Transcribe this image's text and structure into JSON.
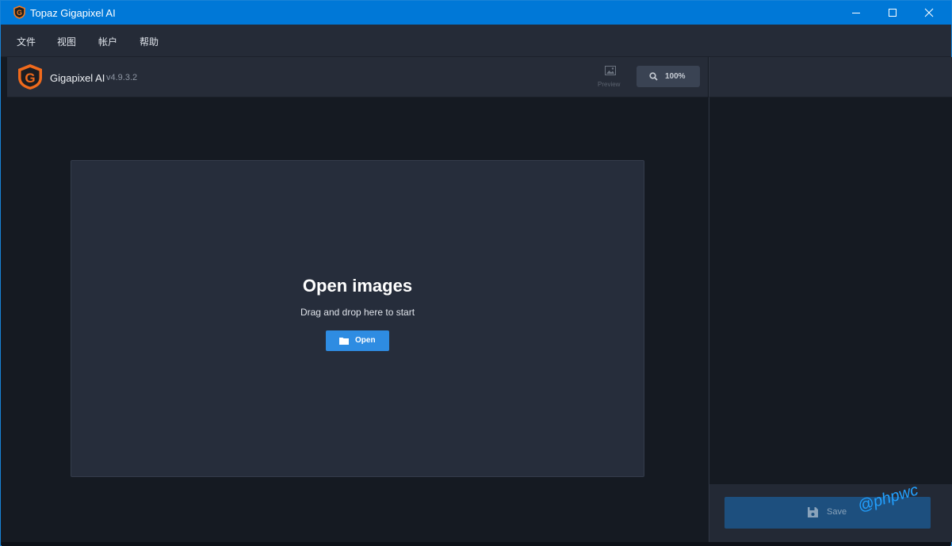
{
  "window": {
    "title": "Topaz Gigapixel AI",
    "icon": "topaz-logo-icon",
    "controls": [
      "minimize-icon",
      "maximize-icon",
      "close-icon"
    ]
  },
  "menu": {
    "items": [
      {
        "label": "文件"
      },
      {
        "label": "视图"
      },
      {
        "label": "帐户"
      },
      {
        "label": "帮助"
      }
    ]
  },
  "header": {
    "app_name": "Gigapixel AI",
    "version": "v4.9.3.2",
    "preview_label": "Preview",
    "preview_icon": "image-icon",
    "zoom_label": "100%",
    "zoom_icon": "search-icon"
  },
  "dropzone": {
    "title": "Open images",
    "subtitle": "Drag and drop here to start",
    "open_label": "Open",
    "open_icon": "folder-icon"
  },
  "footer": {
    "save_label": "Save",
    "save_icon": "save-icon"
  },
  "watermark": "@phpwc",
  "colors": {
    "titlebar": "#0078d7",
    "panel": "#262c38",
    "canvas": "#151a22",
    "accent": "#2e8ce2",
    "logo_orange": "#ef6c1a"
  }
}
